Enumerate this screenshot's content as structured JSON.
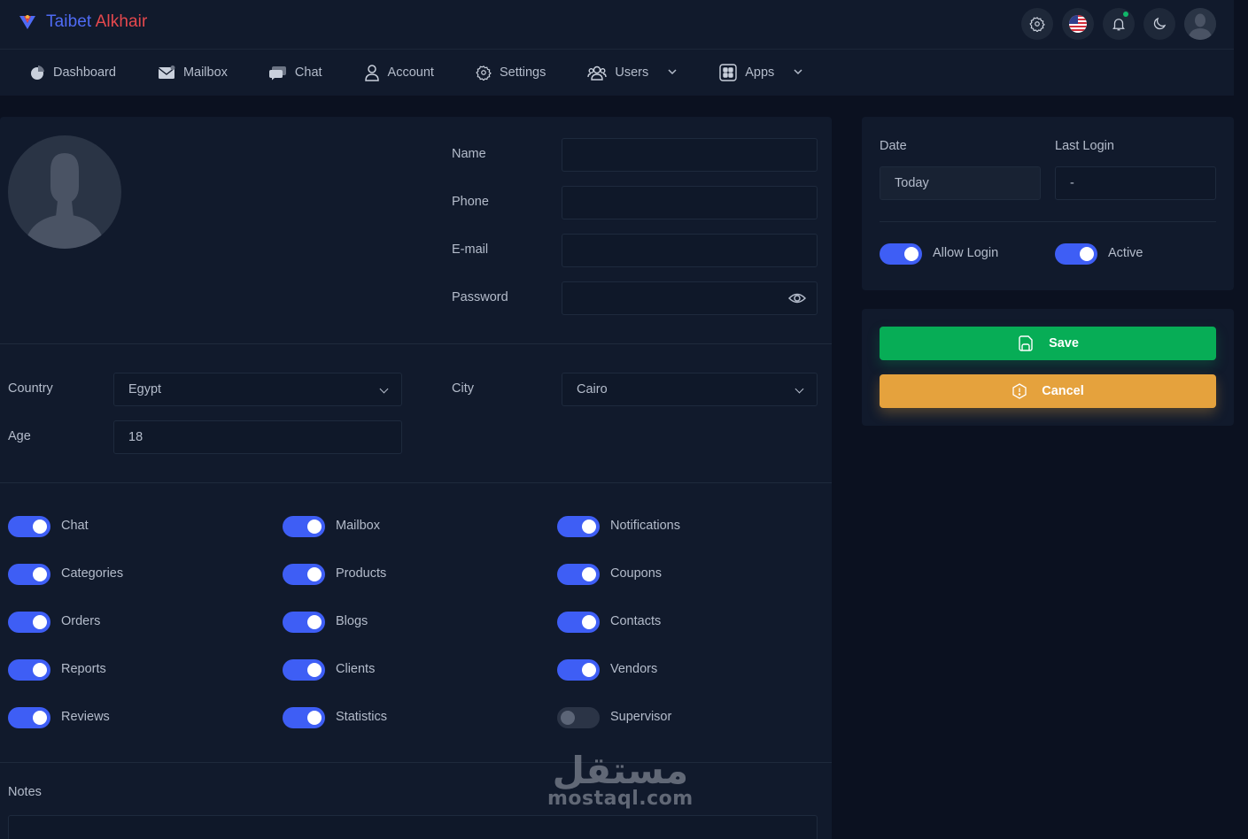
{
  "brand": {
    "name_part1": "Taibet",
    "name_part2": "Alkhair"
  },
  "topbar": {
    "icons": [
      "settings-icon",
      "us-flag-icon",
      "bell-icon",
      "moon-icon",
      "user-avatar-icon"
    ]
  },
  "nav": {
    "items": [
      {
        "label": "Dashboard",
        "icon": "pie-chart-icon"
      },
      {
        "label": "Mailbox",
        "icon": "mail-icon"
      },
      {
        "label": "Chat",
        "icon": "chat-icon"
      },
      {
        "label": "Account",
        "icon": "user-icon"
      },
      {
        "label": "Settings",
        "icon": "gear-icon"
      },
      {
        "label": "Users",
        "icon": "users-icon",
        "dropdown": true
      },
      {
        "label": "Apps",
        "icon": "grid-icon",
        "dropdown": true
      }
    ]
  },
  "form": {
    "name_label": "Name",
    "name_value": "",
    "phone_label": "Phone",
    "phone_value": "",
    "email_label": "E-mail",
    "email_value": "",
    "password_label": "Password",
    "password_value": "",
    "country_label": "Country",
    "country_value": "Egypt",
    "city_label": "City",
    "city_value": "Cairo",
    "age_label": "Age",
    "age_value": "18",
    "notes_label": "Notes"
  },
  "permissions": [
    {
      "label": "Chat",
      "on": true
    },
    {
      "label": "Mailbox",
      "on": true
    },
    {
      "label": "Notifications",
      "on": true
    },
    {
      "label": "Categories",
      "on": true
    },
    {
      "label": "Products",
      "on": true
    },
    {
      "label": "Coupons",
      "on": true
    },
    {
      "label": "Orders",
      "on": true
    },
    {
      "label": "Blogs",
      "on": true
    },
    {
      "label": "Contacts",
      "on": true
    },
    {
      "label": "Reports",
      "on": true
    },
    {
      "label": "Clients",
      "on": true
    },
    {
      "label": "Vendors",
      "on": true
    },
    {
      "label": "Reviews",
      "on": true
    },
    {
      "label": "Statistics",
      "on": true
    },
    {
      "label": "Supervisor",
      "on": false
    }
  ],
  "side": {
    "date_label": "Date",
    "date_value": "Today",
    "last_login_label": "Last Login",
    "last_login_value": "-",
    "allow_login_label": "Allow Login",
    "allow_login_on": true,
    "active_label": "Active",
    "active_on": true
  },
  "actions": {
    "save_label": "Save",
    "cancel_label": "Cancel"
  },
  "colors": {
    "accent": "#3e5ef5",
    "save": "#07ad56",
    "cancel": "#e5a23d",
    "background": "#0b1120",
    "panel": "#111a2c"
  },
  "watermark": {
    "arabic": "مستقل",
    "latin": "mostaql.com"
  }
}
